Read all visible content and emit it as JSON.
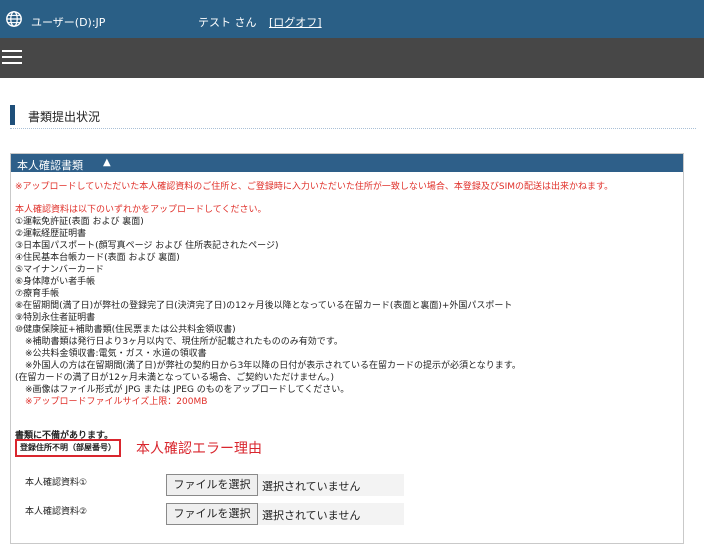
{
  "header": {
    "user": "ユーザー(D):JP",
    "name": "テスト さん",
    "logout": "[ログオフ]"
  },
  "page_title": "書類提出状況",
  "panel": {
    "title": "本人確認書類",
    "arrow": "▲",
    "notice": "※アップロードしていただいた本人確認資料のご住所と、ご登録時に入力いただいた住所が一致しない場合、本登録及びSIMの配送は出来かねます。",
    "intro": "本人確認資料は以下のいずれかをアップロードしてください。",
    "items": [
      "①運転免許証(表面 および 裏面)",
      "②運転経歴証明書",
      "③日本国パスポート(顔写真ページ および 住所表記されたページ)",
      "④住民基本台帳カード(表面 および 裏面)",
      "⑤マイナンバーカード",
      "⑥身体障がい者手帳",
      "⑦療育手帳",
      "⑧在留期間(満了日)が弊社の登録完了日(決済完了日)の12ヶ月後以降となっている在留カード(表面と裏面)+外国パスポート",
      "⑨特別永住者証明書",
      "⑩健康保険証+補助書類(住民票または公共料金領収書)"
    ],
    "notes": [
      "※補助書類は発行日より3ヶ月以内で、現住所が記載されたもののみ有効です。",
      "※公共料金領収書:電気・ガス・水道の領収書",
      "※外国人の方は在留期間(満了日)が弊社の契約日から3年以降の日付が表示されている在留カードの提示が必須となります。",
      "(在留カードの満了日が12ヶ月未満となっている場合、ご契約いただけません。)",
      "※画像はファイル形式が JPG または JPEG のものをアップロードしてください。"
    ],
    "size_limit": "※アップロードファイルサイズ上限：200MB",
    "defect": "書類に不備があります。",
    "error_code": "登録住所不明（部屋番号）",
    "error_label": "本人確認エラー理由",
    "uploads": [
      {
        "label": "本人確認資料①",
        "button": "ファイルを選択",
        "status": "選択されていません"
      },
      {
        "label": "本人確認資料②",
        "button": "ファイルを選択",
        "status": "選択されていません"
      }
    ]
  },
  "colors": {
    "header_bg": "#2a5f86",
    "menu_bg": "#474747",
    "panel_header_bg": "#2e5f89",
    "alert_red": "#e0302a"
  },
  "icons": [
    "globe-icon",
    "hamburger-menu-icon"
  ]
}
